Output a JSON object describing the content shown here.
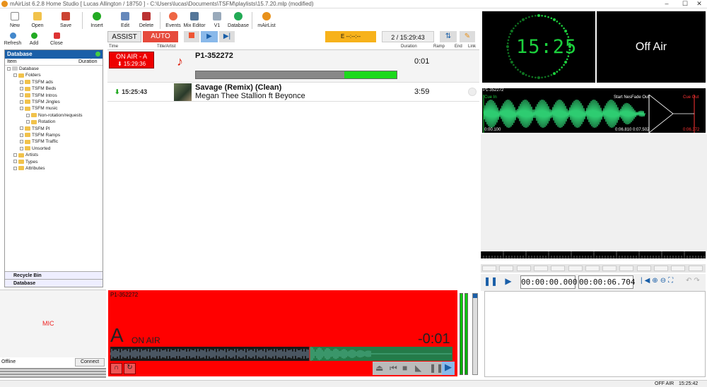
{
  "window": {
    "title": "mAirList 6.2.8 Home Studio [ Lucas Allington / 18750 ] - C:\\Users\\lucas\\Documents\\TSFM\\playlists\\15.7.20.mlp (modified)"
  },
  "toolbar": {
    "new": "New",
    "open": "Open",
    "save": "Save",
    "insert": "Insert",
    "edit": "Edit",
    "delete": "Delete",
    "events": "Events",
    "mix_editor": "Mix Editor",
    "v1": "V1",
    "database": "Database",
    "mairlist": "mAirList"
  },
  "toolbar2": {
    "refresh": "Refresh",
    "add": "Add",
    "close": "Close"
  },
  "db": {
    "title": "Database",
    "col_item": "Item",
    "col_duration": "Duration",
    "tree": [
      {
        "label": "Database",
        "indent": 0
      },
      {
        "label": "Folders",
        "indent": 1
      },
      {
        "label": "TSFM ads",
        "indent": 2
      },
      {
        "label": "TSFM Beds",
        "indent": 2
      },
      {
        "label": "TSFM Intros",
        "indent": 2
      },
      {
        "label": "TSFM Jingles",
        "indent": 2
      },
      {
        "label": "TSFM music",
        "indent": 2
      },
      {
        "label": "Non-rotation/requests",
        "indent": 3
      },
      {
        "label": "Rotation",
        "indent": 3
      },
      {
        "label": "TSFM PI",
        "indent": 2
      },
      {
        "label": "TSFM Ramps",
        "indent": 2
      },
      {
        "label": "TSFM Traffic",
        "indent": 2
      },
      {
        "label": "Unsorted",
        "indent": 2
      },
      {
        "label": "Artists",
        "indent": 1
      },
      {
        "label": "Types",
        "indent": 1
      },
      {
        "label": "Attributes",
        "indent": 1
      }
    ],
    "recycle_bin": "Recycle Bin",
    "database_tab": "Database"
  },
  "playbar": {
    "assist": "ASSIST",
    "auto": "AUTO",
    "eta": "E  --:--:--",
    "position": "2 / 15:29:43"
  },
  "playlist_header": {
    "time": "Time",
    "title_artist": "Title/Artist",
    "duration": "Duration",
    "ramp": "Ramp",
    "end": "End",
    "link": "Link"
  },
  "playlist": [
    {
      "status": "ON AIR - A",
      "time": "15:29:36",
      "title": "P1-352272",
      "artist": "",
      "duration": "0:01",
      "progress": 0.74
    },
    {
      "status": "",
      "time": "15:25:43",
      "title": "Savage (Remix) (Clean)",
      "artist": "Megan Thee Stallion ft Beyonce",
      "duration": "3:59"
    }
  ],
  "clock": {
    "time": "15:25"
  },
  "offair": {
    "label": "Off Air"
  },
  "waveform": {
    "title": "P1-352272",
    "cue_in": "Cue In",
    "start_next_fade_out": "Start NesFade Out",
    "cue_out": "Cue Out",
    "start_time": "0:00.100",
    "markers": "0:06.810 0:07.502",
    "end_time": "0:06.372"
  },
  "editor": {
    "position": "00:00:00.000",
    "length": "00:00:06.704"
  },
  "mic": {
    "label": "MIC",
    "status": "Offline",
    "connect": "Connect"
  },
  "player": {
    "title": "P1-352272",
    "letter": "A",
    "state": "ON AIR",
    "remaining": "-0:01"
  },
  "status": {
    "onair": "OFF AIR",
    "time": "15:25:42"
  },
  "colors": {
    "onair_red": "#ff0000",
    "green": "#2ecc40",
    "accent_blue": "#1a5fa8",
    "assist_bg": "#f0a8a8"
  }
}
